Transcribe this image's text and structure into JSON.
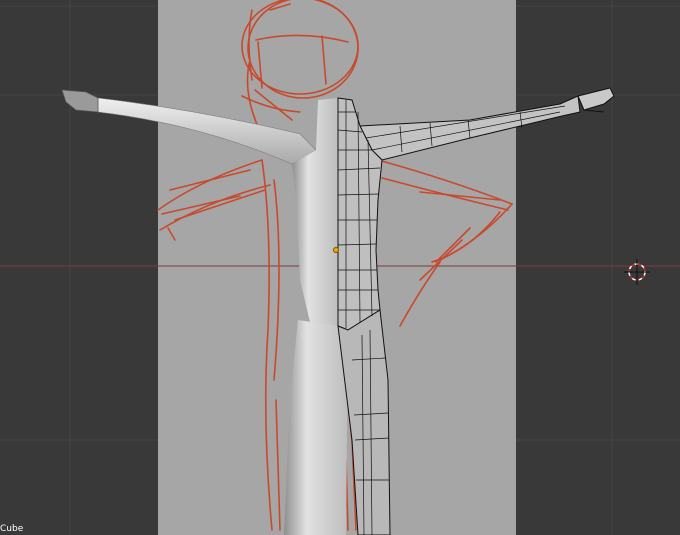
{
  "viewport": {
    "object_name": "Cube",
    "background_color": "#393939",
    "grid_color": "#454545",
    "reference_panel_color": "#a6a6a6",
    "sketch_color": "#c84a2e",
    "mesh_color": "#d6d6d6",
    "wire_color": "#111111",
    "origin_color": "#e8a400",
    "cursor_colors": [
      "#ffffff",
      "#e02020"
    ],
    "x_axis_color": "#7a3a3a"
  }
}
